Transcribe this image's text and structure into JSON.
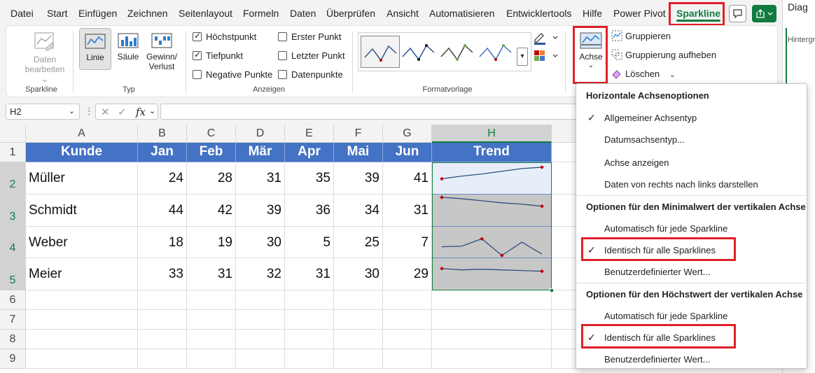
{
  "menu": {
    "tabs": [
      "Datei",
      "Start",
      "Einfügen",
      "Zeichnen",
      "Seitenlayout",
      "Formeln",
      "Daten",
      "Überprüfen",
      "Ansicht",
      "Automatisieren",
      "Entwicklertools",
      "Hilfe",
      "Power Pivot"
    ],
    "active_tab": "Sparkline",
    "side_pane_text": "Diag",
    "side_pane_text2": "Hintergr"
  },
  "ribbon": {
    "sparkline_group": {
      "label": "Sparkline",
      "daten_bearbeiten_line1": "Daten",
      "daten_bearbeiten_line2": "bearbeiten"
    },
    "typ_group": {
      "label": "Typ",
      "linie": "Linie",
      "saeule": "Säule",
      "gewinn_line1": "Gewinn/",
      "gewinn_line2": "Verlust"
    },
    "anzeigen_group": {
      "label": "Anzeigen",
      "checkboxes": [
        {
          "label": "Höchstpunkt",
          "checked": true
        },
        {
          "label": "Tiefpunkt",
          "checked": true
        },
        {
          "label": "Negative Punkte",
          "checked": false
        },
        {
          "label": "Erster Punkt",
          "checked": false
        },
        {
          "label": "Letzter Punkt",
          "checked": false
        },
        {
          "label": "Datenpunkte",
          "checked": false
        }
      ]
    },
    "formatvorlage_group": {
      "label": "Formatvorlage"
    },
    "achse_button": "Achse",
    "gruppieren": "Gruppieren",
    "gruppierung_aufheben": "Gruppierung aufheben",
    "loeschen": "Löschen"
  },
  "formula_bar": {
    "name_box": "H2",
    "fx": "fx",
    "formula": ""
  },
  "sheet": {
    "columns": [
      "A",
      "B",
      "C",
      "D",
      "E",
      "F",
      "G",
      "H"
    ],
    "rows": [
      "1",
      "2",
      "3",
      "4",
      "5",
      "6",
      "7",
      "8",
      "9"
    ],
    "header_row": [
      "Kunde",
      "Jan",
      "Feb",
      "Mär",
      "Apr",
      "Mai",
      "Jun",
      "Trend"
    ],
    "data": [
      {
        "name": "Müller",
        "values": [
          24,
          28,
          31,
          35,
          39,
          41
        ]
      },
      {
        "name": "Schmidt",
        "values": [
          44,
          42,
          39,
          36,
          34,
          31
        ]
      },
      {
        "name": "Weber",
        "values": [
          18,
          19,
          30,
          5,
          25,
          7
        ]
      },
      {
        "name": "Meier",
        "values": [
          33,
          31,
          32,
          31,
          30,
          29
        ]
      }
    ],
    "sparkline_axis_min": 5,
    "sparkline_axis_max": 44,
    "colors": {
      "header_fill": "#4472c4",
      "sparkline_line": "#2f4f7f",
      "marker": "#c00000",
      "selection": "#107c41"
    }
  },
  "axis_menu": {
    "section1_title": "Horizontale Achsenoptionen",
    "s1_item1": "Allgemeiner Achsentyp",
    "s1_item2": "Datumsachsentyp...",
    "s1_item3": "Achse anzeigen",
    "s1_item4": "Daten von rechts nach links darstellen",
    "section2_title": "Optionen für den Minimalwert der vertikalen Achse",
    "s2_item1": "Automatisch für jede Sparkline",
    "s2_item2": "Identisch für alle Sparklines",
    "s2_item3": "Benutzerdefinierter Wert...",
    "section3_title": "Optionen für den Höchstwert der vertikalen Achse",
    "s3_item1": "Automatisch für jede Sparkline",
    "s3_item2": "Identisch für alle Sparklines",
    "s3_item3": "Benutzerdefinierter Wert..."
  }
}
